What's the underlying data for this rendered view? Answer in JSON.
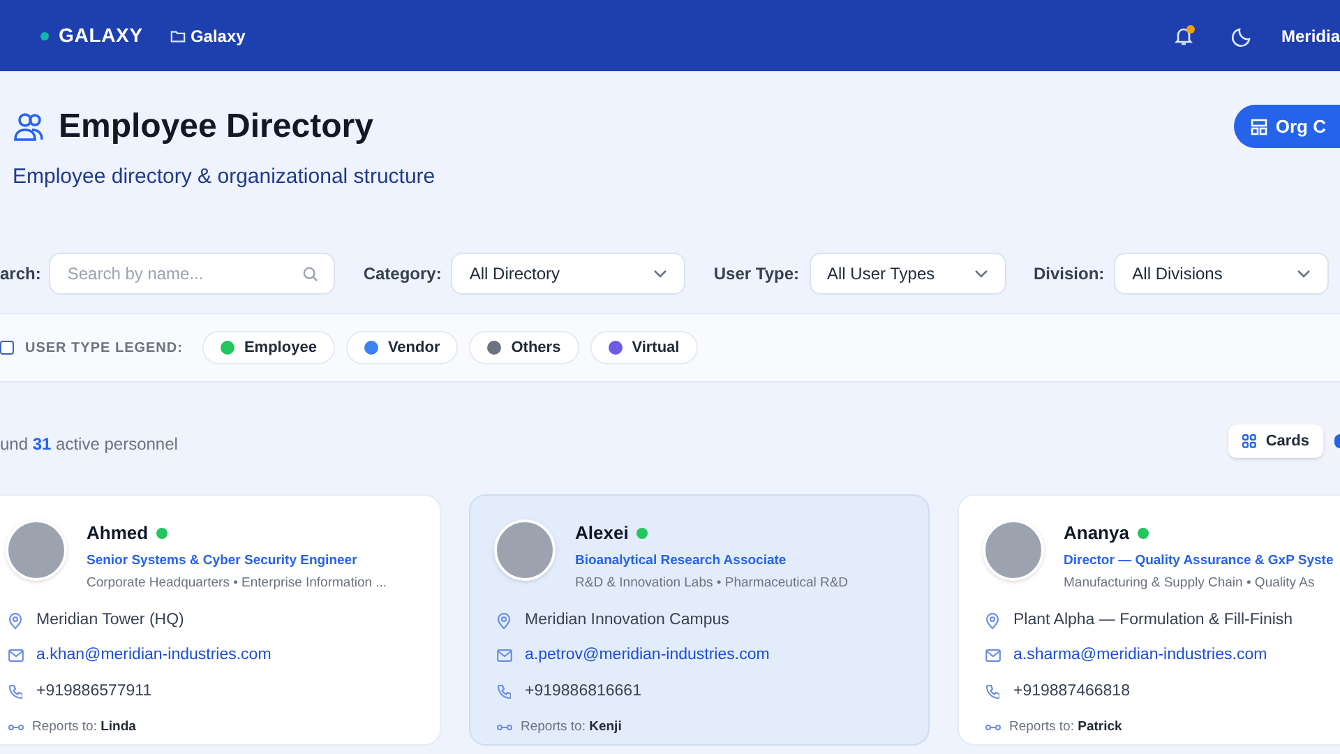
{
  "topbar": {
    "brand": "GALAXY",
    "breadcrumb": "Galaxy",
    "notification_dot": true,
    "user": "Meridia"
  },
  "header": {
    "title": "Employee Directory",
    "subtitle": "Employee directory & organizational structure",
    "action": "Org C"
  },
  "filters": {
    "search_label": "arch:",
    "search_placeholder": "Search by name...",
    "selects": [
      {
        "label": "Category:",
        "value": "All Directory"
      },
      {
        "label": "User Type:",
        "value": "All User Types"
      },
      {
        "label": "Division:",
        "value": "All Divisions"
      }
    ]
  },
  "legend": {
    "checked": false,
    "label": "USER TYPE LEGEND:",
    "items": [
      {
        "label": "Employee",
        "color": "#22c55e"
      },
      {
        "label": "Vendor",
        "color": "#3b82f6"
      },
      {
        "label": "Others",
        "color": "#6b7280"
      },
      {
        "label": "Virtual",
        "color": "#6d5ce8"
      }
    ]
  },
  "summary": {
    "prefix": "und",
    "count": "31",
    "suffix": "active personnel"
  },
  "views": [
    {
      "label": "Cards",
      "selected": true
    }
  ],
  "cards": [
    {
      "name": "Ahmed",
      "online": true,
      "selected": false,
      "title": "Senior Systems & Cyber Security Engineer",
      "org": "Corporate Headquarters • Enterprise Information ...",
      "location": "Meridian Tower (HQ)",
      "email": "a.khan@meridian-industries.com",
      "phone": "+919886577911",
      "reports_label": "Reports to:",
      "reports_to": "Linda"
    },
    {
      "name": "Alexei",
      "online": true,
      "selected": true,
      "title": "Bioanalytical Research Associate",
      "org": "R&D & Innovation Labs • Pharmaceutical R&D",
      "location": "Meridian Innovation Campus",
      "email": "a.petrov@meridian-industries.com",
      "phone": "+919886816661",
      "reports_label": "Reports to:",
      "reports_to": "Kenji"
    },
    {
      "name": "Ananya",
      "online": true,
      "selected": false,
      "title": "Director — Quality Assurance & GxP Syste",
      "org": "Manufacturing & Supply Chain • Quality As",
      "location": "Plant Alpha — Formulation & Fill-Finish",
      "email": "a.sharma@meridian-industries.com",
      "phone": "+919887466818",
      "reports_label": "Reports to:",
      "reports_to": "Patrick"
    }
  ]
}
